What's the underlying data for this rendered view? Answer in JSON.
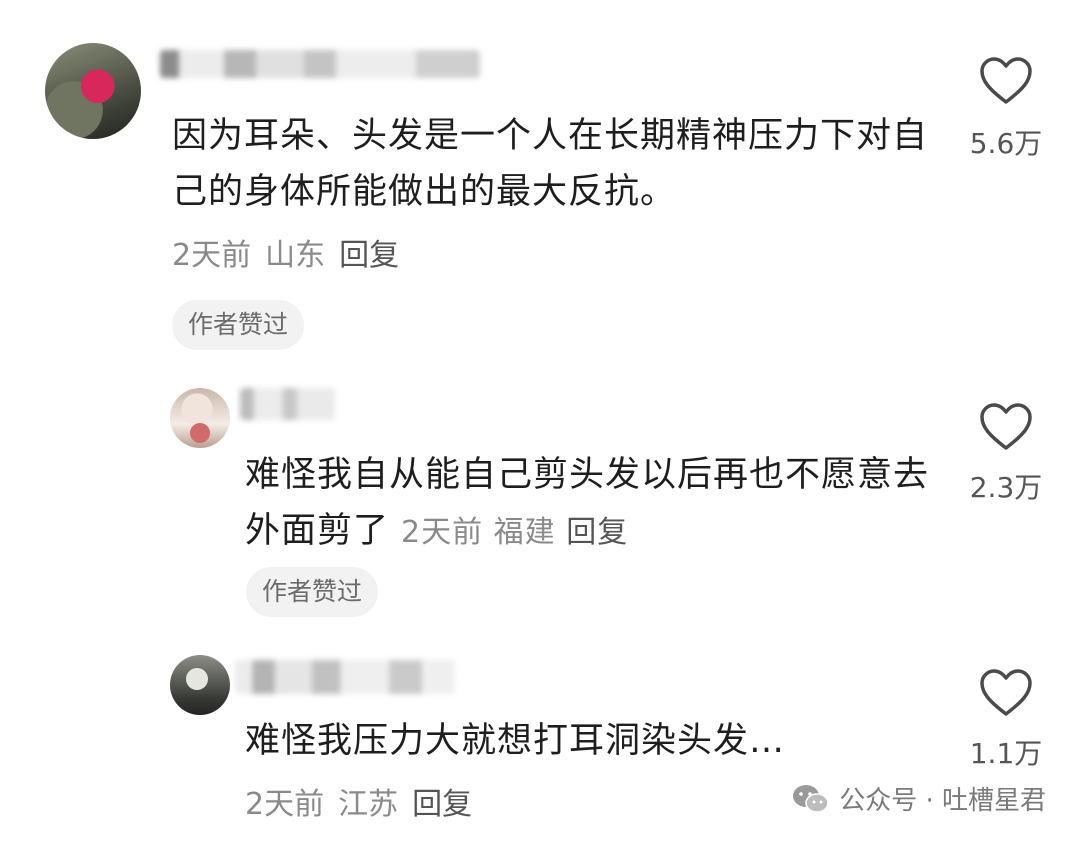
{
  "comments": [
    {
      "text": "因为耳朵、头发是一个人在长期精神压力下对自己的身体所能做出的最大反抗。",
      "time": "2天前",
      "location": "山东",
      "reply_label": "回复",
      "badge": "作者赞过",
      "likes": "5.6万"
    },
    {
      "text": "难怪我自从能自己剪头发以后再也不愿意去外面剪了",
      "time": "2天前",
      "location": "福建",
      "reply_label": "回复",
      "badge": "作者赞过",
      "likes": "2.3万"
    },
    {
      "text": "难怪我压力大就想打耳洞染头发…",
      "time": "2天前",
      "location": "江苏",
      "reply_label": "回复",
      "likes": "1.1万"
    }
  ],
  "watermark": {
    "text": "公众号 · 吐槽星君",
    "icon": "wechat-icon"
  },
  "icons": {
    "like": "heart-outline-icon"
  }
}
